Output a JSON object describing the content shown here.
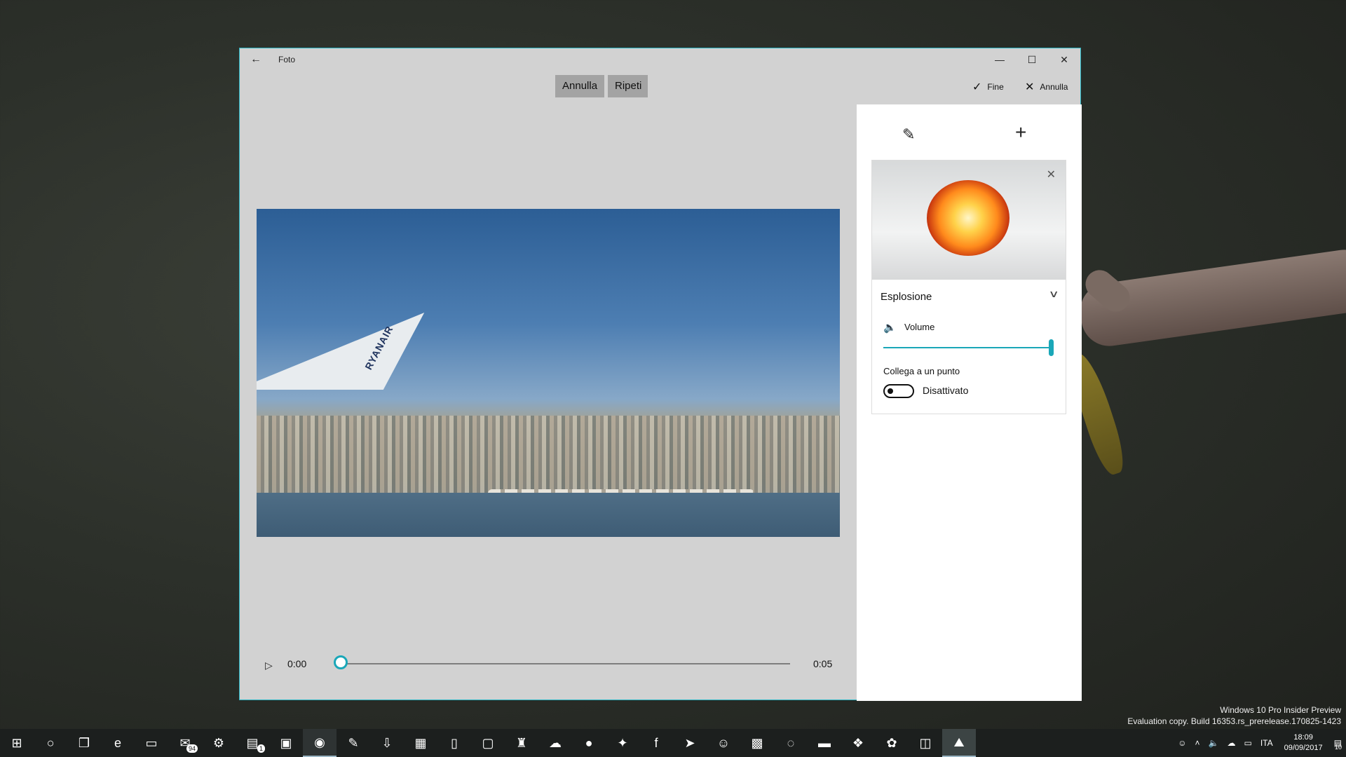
{
  "window": {
    "title": "Foto"
  },
  "toolbar": {
    "undo_label": "Annulla",
    "redo_label": "Ripeti",
    "done_label": "Fine",
    "cancel_label": "Annulla"
  },
  "video": {
    "wing_text": "RYANAIR"
  },
  "playback": {
    "current_time": "0:00",
    "end_time": "0:05",
    "progress": 0
  },
  "effect_panel": {
    "effect_name": "Esplosione",
    "volume_label": "Volume",
    "volume_level": 1.0,
    "link_label": "Collega a un punto",
    "toggle_label": "Disattivato",
    "toggle_on": false
  },
  "watermark": {
    "line1": "Windows 10 Pro Insider Preview",
    "line2": "Evaluation copy. Build 16353.rs_prerelease.170825-1423"
  },
  "taskbar": {
    "items": [
      {
        "icon": "windows-start-icon",
        "glyph": "⊞"
      },
      {
        "icon": "cortana-search-icon",
        "glyph": "○"
      },
      {
        "icon": "task-view-icon",
        "glyph": "❐"
      },
      {
        "icon": "edge-browser-icon",
        "glyph": "e"
      },
      {
        "icon": "file-explorer-icon",
        "glyph": "▭"
      },
      {
        "icon": "mail-icon",
        "glyph": "✉",
        "badge": "94"
      },
      {
        "icon": "settings-gear-icon",
        "glyph": "⚙"
      },
      {
        "icon": "documents-icon",
        "glyph": "▤",
        "badge": "1"
      },
      {
        "icon": "store-icon",
        "glyph": "▣"
      },
      {
        "icon": "chrome-icon",
        "glyph": "◉"
      },
      {
        "icon": "paint-icon",
        "glyph": "✎"
      },
      {
        "icon": "download-icon",
        "glyph": "⇩"
      },
      {
        "icon": "windows-icon",
        "glyph": "▦"
      },
      {
        "icon": "phone-icon",
        "glyph": "▯"
      },
      {
        "icon": "remote-icon",
        "glyph": "▢"
      },
      {
        "icon": "mixed-reality-icon",
        "glyph": "♜"
      },
      {
        "icon": "soundcloud-icon",
        "glyph": "☁"
      },
      {
        "icon": "spotify-icon",
        "glyph": "●"
      },
      {
        "icon": "twitter-icon",
        "glyph": "✦"
      },
      {
        "icon": "facebook-icon",
        "glyph": "f"
      },
      {
        "icon": "telegram-icon",
        "glyph": "➤"
      },
      {
        "icon": "people-icon",
        "glyph": "☺"
      },
      {
        "icon": "xbox-icon",
        "glyph": "▩"
      },
      {
        "icon": "cortana-feedback-icon",
        "glyph": "◌"
      },
      {
        "icon": "folder-icon",
        "glyph": "▬"
      },
      {
        "icon": "dropbox-icon",
        "glyph": "❖"
      },
      {
        "icon": "paint3d-icon",
        "glyph": "✿"
      },
      {
        "icon": "web-app-icon",
        "glyph": "◫"
      },
      {
        "icon": "photos-icon",
        "glyph": "⛰"
      }
    ],
    "tray": {
      "language": "ITA",
      "time": "18:09",
      "date": "09/09/2017",
      "notifications": "10"
    }
  }
}
